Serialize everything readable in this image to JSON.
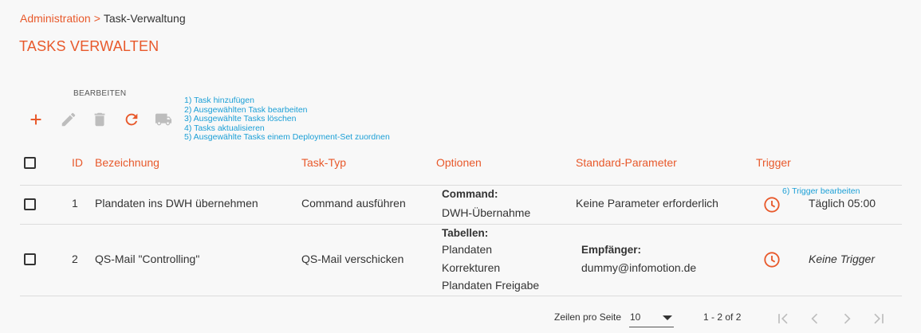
{
  "breadcrumb": {
    "parent": "Administration",
    "separator": ">",
    "current": "Task-Verwaltung"
  },
  "page_title": "TASKS VERWALTEN",
  "toolbar": {
    "heading": "BEARBEITEN",
    "buttons": [
      {
        "icon": "plus-icon",
        "enabled": true
      },
      {
        "icon": "pencil-icon",
        "enabled": false
      },
      {
        "icon": "trash-icon",
        "enabled": false
      },
      {
        "icon": "refresh-icon",
        "enabled": true
      },
      {
        "icon": "truck-icon",
        "enabled": false
      }
    ],
    "hints": [
      "1) Task hinzufügen",
      "2) Ausgewählten Task bearbeiten",
      "3) Ausgewählte Tasks löschen",
      "4) Tasks aktualisieren",
      "5) Ausgewählte Tasks einem Deployment-Set zuordnen"
    ]
  },
  "table": {
    "columns": {
      "id": "ID",
      "name": "Bezeichnung",
      "type": "Task-Typ",
      "options": "Optionen",
      "params": "Standard-Parameter",
      "trigger": "Trigger"
    },
    "trigger_hint": "6) Trigger bearbeiten",
    "rows": [
      {
        "id": "1",
        "name": "Plandaten ins DWH übernehmen",
        "type": "Command ausführen",
        "options_label": "Command:",
        "options_values": [
          "DWH-Übernahme"
        ],
        "params_label": "",
        "params_value": "Keine Parameter erforderlich",
        "trigger": "Täglich 05:00"
      },
      {
        "id": "2",
        "name": "QS-Mail \"Controlling\"",
        "type": "QS-Mail verschicken",
        "options_label": "Tabellen:",
        "options_values": [
          "Plandaten",
          "Korrekturen",
          "Plandaten Freigabe"
        ],
        "params_label": "Empfänger:",
        "params_value": "dummy@infomotion.de",
        "trigger": "Keine Trigger"
      }
    ]
  },
  "footer": {
    "rows_per_page_label": "Zeilen pro Seite",
    "rows_per_page_value": "10",
    "range": "1 - 2 of 2"
  },
  "colors": {
    "accent": "#e8592b",
    "hint": "#1b9fd6",
    "disabled": "#bdbdbd"
  }
}
